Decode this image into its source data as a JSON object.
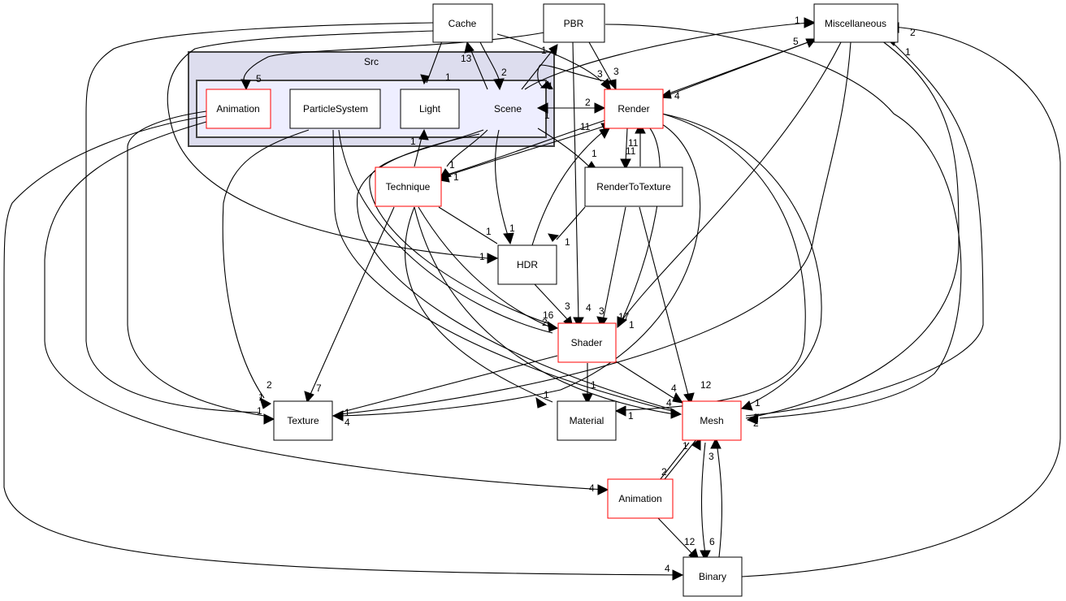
{
  "diagram": {
    "type": "directory-dependency-graph",
    "colors": {
      "cluster_outer_fill": "#ddddee",
      "cluster_inner_fill": "#eeeeff",
      "cluster_border": "#444444",
      "node_border_default": "#000000",
      "node_border_has_children": "#ff0000",
      "node_fill": "#ffffff",
      "edge": "#000000"
    },
    "clusters": [
      {
        "id": "src",
        "label": "Src"
      }
    ],
    "nodes": [
      {
        "id": "cache",
        "label": "Cache",
        "border": "black"
      },
      {
        "id": "pbr",
        "label": "PBR",
        "border": "black"
      },
      {
        "id": "misc",
        "label": "Miscellaneous",
        "border": "black"
      },
      {
        "id": "src_anim",
        "label": "Animation",
        "border": "red",
        "cluster": "src"
      },
      {
        "id": "particle",
        "label": "ParticleSystem",
        "border": "black",
        "cluster": "src"
      },
      {
        "id": "light",
        "label": "Light",
        "border": "black",
        "cluster": "src"
      },
      {
        "id": "scene",
        "label": "Scene",
        "border": "none",
        "cluster": "src"
      },
      {
        "id": "render",
        "label": "Render",
        "border": "red"
      },
      {
        "id": "technique",
        "label": "Technique",
        "border": "red"
      },
      {
        "id": "rtt",
        "label": "RenderToTexture",
        "border": "black"
      },
      {
        "id": "hdr",
        "label": "HDR",
        "border": "black"
      },
      {
        "id": "shader",
        "label": "Shader",
        "border": "red"
      },
      {
        "id": "texture",
        "label": "Texture",
        "border": "black"
      },
      {
        "id": "material",
        "label": "Material",
        "border": "black"
      },
      {
        "id": "mesh",
        "label": "Mesh",
        "border": "red"
      },
      {
        "id": "animation",
        "label": "Animation",
        "border": "red"
      },
      {
        "id": "binary",
        "label": "Binary",
        "border": "black"
      }
    ],
    "edge_labels": [
      {
        "id": "l1",
        "text": "13"
      },
      {
        "id": "l2",
        "text": "2"
      },
      {
        "id": "l3",
        "text": "1"
      },
      {
        "id": "l4",
        "text": "5"
      },
      {
        "id": "l5",
        "text": "1"
      },
      {
        "id": "l6",
        "text": "3"
      },
      {
        "id": "l7",
        "text": "3"
      },
      {
        "id": "l8",
        "text": "1"
      },
      {
        "id": "l9",
        "text": "5"
      },
      {
        "id": "l10",
        "text": "2"
      },
      {
        "id": "l11",
        "text": "1"
      },
      {
        "id": "l12",
        "text": "4"
      },
      {
        "id": "l13",
        "text": "2"
      },
      {
        "id": "l14",
        "text": "11"
      },
      {
        "id": "l15",
        "text": "11"
      },
      {
        "id": "l16",
        "text": "11"
      },
      {
        "id": "l17",
        "text": "1"
      },
      {
        "id": "l18",
        "text": "1"
      },
      {
        "id": "l19",
        "text": "1"
      },
      {
        "id": "l20",
        "text": "1"
      },
      {
        "id": "l21",
        "text": "1"
      },
      {
        "id": "l22",
        "text": "1"
      },
      {
        "id": "l23",
        "text": "1"
      },
      {
        "id": "l24",
        "text": "1"
      },
      {
        "id": "l25",
        "text": "1"
      },
      {
        "id": "l26",
        "text": "3"
      },
      {
        "id": "l27",
        "text": "16"
      },
      {
        "id": "l28",
        "text": "2"
      },
      {
        "id": "l29",
        "text": "4"
      },
      {
        "id": "l30",
        "text": "3"
      },
      {
        "id": "l31",
        "text": "17"
      },
      {
        "id": "l32",
        "text": "1"
      },
      {
        "id": "l33",
        "text": "2"
      },
      {
        "id": "l34",
        "text": "7"
      },
      {
        "id": "l35",
        "text": "1"
      },
      {
        "id": "l36",
        "text": "1"
      },
      {
        "id": "l37",
        "text": "1"
      },
      {
        "id": "l38",
        "text": "4"
      },
      {
        "id": "l39",
        "text": "1"
      },
      {
        "id": "l40",
        "text": "1"
      },
      {
        "id": "l41",
        "text": "1"
      },
      {
        "id": "l42",
        "text": "4"
      },
      {
        "id": "l43",
        "text": "4"
      },
      {
        "id": "l44",
        "text": "12"
      },
      {
        "id": "l45",
        "text": "1"
      },
      {
        "id": "l46",
        "text": "3"
      },
      {
        "id": "l47",
        "text": "2"
      },
      {
        "id": "l48",
        "text": "1"
      },
      {
        "id": "l49",
        "text": "2"
      },
      {
        "id": "l50",
        "text": "3"
      },
      {
        "id": "l51",
        "text": "4"
      },
      {
        "id": "l52",
        "text": "12"
      },
      {
        "id": "l53",
        "text": "6"
      },
      {
        "id": "l54",
        "text": "4"
      },
      {
        "id": "l55",
        "text": "1"
      }
    ]
  }
}
